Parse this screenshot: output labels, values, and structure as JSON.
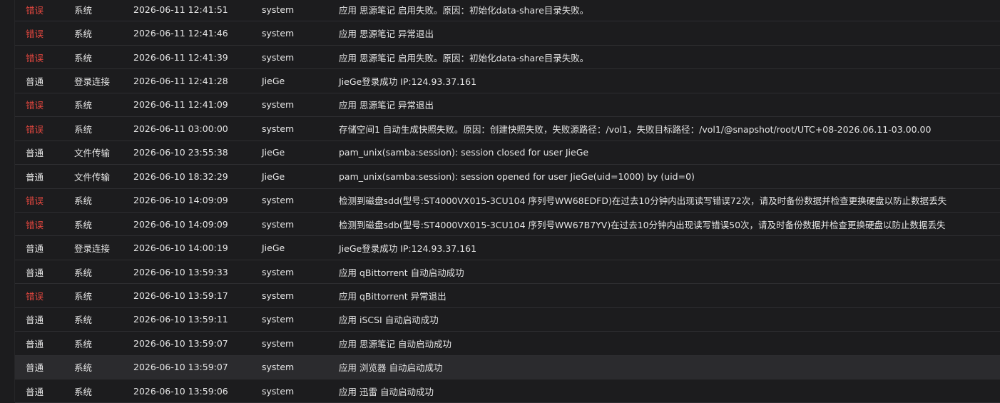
{
  "log": {
    "rows": [
      {
        "level": "错误",
        "level_kind": "error",
        "type": "系统",
        "time": "2026-06-11 12:41:51",
        "user": "system",
        "message": "应用 思源笔记 启用失败。原因：初始化data-share目录失败。"
      },
      {
        "level": "错误",
        "level_kind": "error",
        "type": "系统",
        "time": "2026-06-11 12:41:46",
        "user": "system",
        "message": "应用 思源笔记 异常退出"
      },
      {
        "level": "错误",
        "level_kind": "error",
        "type": "系统",
        "time": "2026-06-11 12:41:39",
        "user": "system",
        "message": "应用 思源笔记 启用失败。原因：初始化data-share目录失败。"
      },
      {
        "level": "普通",
        "level_kind": "normal",
        "type": "登录连接",
        "time": "2026-06-11 12:41:28",
        "user": "JieGe",
        "message": "JieGe登录成功 IP:124.93.37.161"
      },
      {
        "level": "错误",
        "level_kind": "error",
        "type": "系统",
        "time": "2026-06-11 12:41:09",
        "user": "system",
        "message": "应用 思源笔记 异常退出"
      },
      {
        "level": "错误",
        "level_kind": "error",
        "type": "系统",
        "time": "2026-06-11 03:00:00",
        "user": "system",
        "message": "存储空间1 自动生成快照失败。原因：创建快照失败，失败源路径：/vol1，失败目标路径：/vol1/@snapshot/root/UTC+08-2026.06.11-03.00.00"
      },
      {
        "level": "普通",
        "level_kind": "normal",
        "type": "文件传输",
        "time": "2026-06-10 23:55:38",
        "user": "JieGe",
        "message": "pam_unix(samba:session): session closed for user JieGe"
      },
      {
        "level": "普通",
        "level_kind": "normal",
        "type": "文件传输",
        "time": "2026-06-10 18:32:29",
        "user": "JieGe",
        "message": "pam_unix(samba:session): session opened for user JieGe(uid=1000) by (uid=0)"
      },
      {
        "level": "错误",
        "level_kind": "error",
        "type": "系统",
        "time": "2026-06-10 14:09:09",
        "user": "system",
        "message": "检测到磁盘sdd(型号:ST4000VX015-3CU104 序列号WW68EDFD)在过去10分钟内出现读写错误72次，请及时备份数据并检查更换硬盘以防止数据丢失"
      },
      {
        "level": "错误",
        "level_kind": "error",
        "type": "系统",
        "time": "2026-06-10 14:09:09",
        "user": "system",
        "message": "检测到磁盘sdb(型号:ST4000VX015-3CU104 序列号WW67B7YV)在过去10分钟内出现读写错误50次，请及时备份数据并检查更换硬盘以防止数据丢失"
      },
      {
        "level": "普通",
        "level_kind": "normal",
        "type": "登录连接",
        "time": "2026-06-10 14:00:19",
        "user": "JieGe",
        "message": "JieGe登录成功 IP:124.93.37.161"
      },
      {
        "level": "普通",
        "level_kind": "normal",
        "type": "系统",
        "time": "2026-06-10 13:59:33",
        "user": "system",
        "message": "应用 qBittorrent 自动启动成功"
      },
      {
        "level": "错误",
        "level_kind": "error",
        "type": "系统",
        "time": "2026-06-10 13:59:17",
        "user": "system",
        "message": "应用 qBittorrent 异常退出"
      },
      {
        "level": "普通",
        "level_kind": "normal",
        "type": "系统",
        "time": "2026-06-10 13:59:11",
        "user": "system",
        "message": "应用 iSCSI 自动启动成功"
      },
      {
        "level": "普通",
        "level_kind": "normal",
        "type": "系统",
        "time": "2026-06-10 13:59:07",
        "user": "system",
        "message": "应用 思源笔记 自动启动成功"
      },
      {
        "level": "普通",
        "level_kind": "normal",
        "type": "系统",
        "time": "2026-06-10 13:59:07",
        "user": "system",
        "message": "应用 浏览器 自动启动成功",
        "highlight": true
      },
      {
        "level": "普通",
        "level_kind": "normal",
        "type": "系统",
        "time": "2026-06-10 13:59:06",
        "user": "system",
        "message": "应用 迅雷 自动启动成功"
      }
    ]
  },
  "colors": {
    "background": "#1c1c1e",
    "error": "#e0463e",
    "text": "#e6e6e6",
    "row_highlight": "#2b2b2e",
    "divider": "#2e2e31"
  }
}
